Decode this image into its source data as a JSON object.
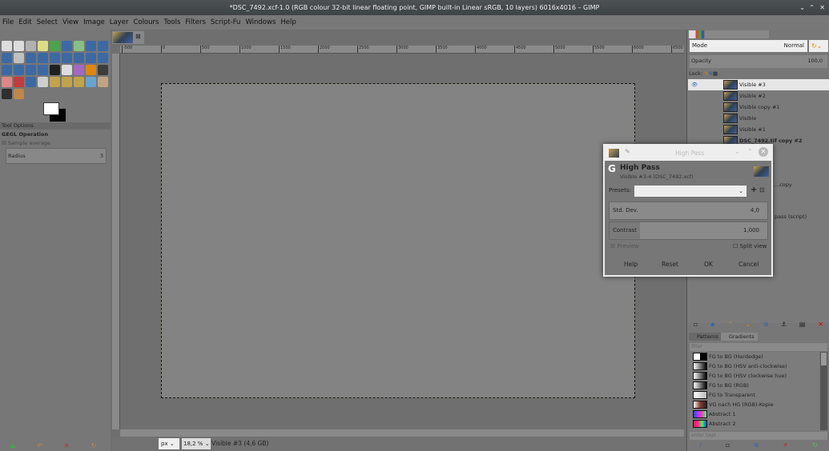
{
  "window": {
    "title": "*DSC_7492.xcf-1.0 (RGB colour 32-bit linear floating point, GIMP built-in Linear sRGB, 10 layers) 6016x4016 – GIMP"
  },
  "menu": [
    "File",
    "Edit",
    "Select",
    "View",
    "Image",
    "Layer",
    "Colours",
    "Tools",
    "Filters",
    "Script-Fu",
    "Windows",
    "Help"
  ],
  "tool_options": {
    "tab": "Tool Options",
    "heading": "GEGL Operation",
    "sample_average": "Sample average",
    "radius_label": "Radius",
    "radius_value": "3"
  },
  "ruler": {
    "labels": [
      "-500",
      "0",
      "500",
      "1000",
      "1500",
      "2000",
      "2500",
      "3000",
      "3500",
      "4000",
      "4500",
      "5000",
      "5500",
      "6000",
      "6500"
    ]
  },
  "status": {
    "unit": "px",
    "zoom": "18,2 %",
    "info": "Visible #3 (4,6 GB)"
  },
  "layers": {
    "mode_label": "Mode",
    "mode_value": "Normal",
    "opacity_label": "Opacity",
    "opacity_value": "100,0",
    "lock_label": "Lock:",
    "items": [
      "Visible #3",
      "Visible #2",
      "Visible copy #1",
      "Visible",
      "Visible #1",
      "DSC_7492.tif copy #2",
      "...copy",
      "",
      "",
      "pass (script)"
    ]
  },
  "gradients": {
    "tabs": [
      "Patterns",
      "Gradients"
    ],
    "filter_placeholder": "filter",
    "tags_placeholder": "enter tags",
    "items": [
      {
        "name": "FG to BG (Hardedge)",
        "css": "linear-gradient(90deg,#fff 50%,#000 50%)"
      },
      {
        "name": "FG to BG (HSV anti-clockwise)",
        "css": "linear-gradient(90deg,#fff,#000)"
      },
      {
        "name": "FG to BG (HSV clockwise hue)",
        "css": "linear-gradient(90deg,#fff,#000)"
      },
      {
        "name": "FG to BG (RGB)",
        "css": "linear-gradient(90deg,#fff,#000)"
      },
      {
        "name": "FG to Transparent",
        "css": "linear-gradient(90deg,#fff,#bbb)"
      },
      {
        "name": "VG nach HG (RGB)-Kopie",
        "css": "linear-gradient(90deg,#fff,#8a3a30,#222)"
      },
      {
        "name": "Abstract 1",
        "css": "linear-gradient(90deg,#3040ff,#a040ff,#ff40a0,#40ffa0)"
      },
      {
        "name": "Abstract 2",
        "css": "linear-gradient(90deg,#ff2040,#ff20a0,#40ff40,#2040ff)"
      }
    ]
  },
  "dialog": {
    "window_title": "High Pass",
    "title": "High Pass",
    "subtitle": "Visible #3-4 (DSC_7492.xcf)",
    "presets_label": "Presets:",
    "presets_value": "",
    "std_dev_label": "Std. Dev.",
    "std_dev_value": "4,0",
    "contrast_label": "Contrast",
    "contrast_value": "1,000",
    "preview_label": "Preview",
    "preview_checked": true,
    "split_label": "Split view",
    "split_checked": false,
    "buttons": {
      "help": "Help",
      "reset": "Reset",
      "ok": "OK",
      "cancel": "Cancel"
    }
  },
  "colors": {
    "selection": "#e8e000",
    "accent": "#2a6ab0"
  }
}
